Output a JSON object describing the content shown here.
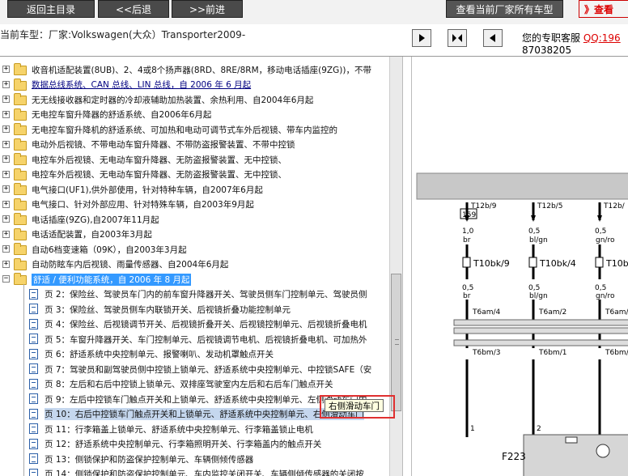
{
  "toolbar": {
    "back_main": "返回主目录",
    "back": "<<后退",
    "forward": ">>前进",
    "all_models": "查看当前厂家所有车型",
    "check": "》查看"
  },
  "info": {
    "current_model": "当前车型：厂家:Volkswagen(大众）Transporter2009-",
    "service_label": "您的专职客服",
    "service_qq": "QQ:196",
    "service_phone": "87038205"
  },
  "tree": {
    "folders": [
      {
        "label": "收音机适配装置(8UB)、2、4或8个扬声器(8RD、8RE/8RM，移动电话插座(9ZG))，不带",
        "style": "normal"
      },
      {
        "label": "数据总线系统、CAN 总线、LIN 总线，自 2006 年 6 月起",
        "style": "blue"
      },
      {
        "label": "无无线接收器和定时器的冷却液辅助加热装置、余热利用、自2004年6月起",
        "style": "normal"
      },
      {
        "label": "无电控车窗升降器的舒适系统、自2006年6月起",
        "style": "normal"
      },
      {
        "label": "无电控车窗升降机的舒适系统、可加热和电动可调节式车外后视镜、带车内监控的",
        "style": "normal"
      },
      {
        "label": "电动外后视镜、不带电动车窗升降器、不带防盗报警装置、不带中控锁",
        "style": "normal"
      },
      {
        "label": "电控车外后视镜、无电动车窗升降器、无防盗报警装置、无中控锁、",
        "style": "normal"
      },
      {
        "label": "电控车外后视镜、无电动车窗升降器、无防盗报警装置、无中控锁、",
        "style": "normal"
      },
      {
        "label": "电气接口(UF1),供外部使用，针对特种车辆，自2007年6月起",
        "style": "normal"
      },
      {
        "label": "电气接口、针对外部应用、针对特殊车辆，自2003年9月起",
        "style": "normal"
      },
      {
        "label": "电话插座(9ZG),自2007年11月起",
        "style": "normal"
      },
      {
        "label": "电话适配装置，自2003年3月起",
        "style": "normal"
      },
      {
        "label": "自动6档变速箱（09K），自2003年3月起",
        "style": "normal"
      },
      {
        "label": "自动防眩车内后视镜、雨量传感器、自2004年6月起",
        "style": "normal"
      },
      {
        "label": "舒适 / 便利功能系统，自 2006 年 8 月起",
        "style": "selected"
      }
    ],
    "pages": [
      "页 2：保险丝、驾驶员车门内的前车窗升降器开关、驾驶员侧车门控制单元、驾驶员侧",
      "页 3：保险丝、驾驶员侧车内联锁开关、后视镜折叠功能控制单元",
      "页 4：保险丝、后视镜调节开关、后视镜折叠开关、后视镜控制单元、后视镜折叠电机",
      "页 5：车窗升降器开关、车门控制单元、后视镜调节电机、后视镜折叠电机、可加热外",
      "页 6：舒适系统中央控制单元、报警喇叭、发动机罩触点开关",
      "页 7：驾驶员和副驾驶员侧中控锁上锁单元、舒适系统中央控制单元、中控锁SAFE（安",
      "页 8：左后和右后中控锁上锁单元、双排座驾驶室内左后和右后车门触点开关",
      "页 9：左后中控锁车门触点开关和上锁单元、舒适系统中央控制单元、左侧滑动车门内",
      "页 10：右后中控锁车门触点开关和上锁单元、舒适系统中央控制单元、右侧滑动车门",
      "页 11：行李箱盖上锁单元、舒适系统中央控制单元、行李箱盖锁止电机",
      "页 12：舒适系统中央控制单元、行李箱照明开关、行李箱盖内的触点开关",
      "页 13：侧锁保护和防盗保护控制单元、车辆侧倾传感器",
      "页 14：侧锁保护和防盗保护控制单元、车内监控关闭开关、车辆侧倾传感器的关闭按"
    ],
    "tooltip": "右侧滑动车门"
  },
  "diagram": {
    "box_label": "159",
    "columns": [
      {
        "top_conn": "T12b/9",
        "size1": "1,0",
        "color1": "br",
        "plug": "T10bk/9",
        "size2": "0,5",
        "color2": "br",
        "mid_conn": "T6am/4",
        "low_conn": "T6bm/3",
        "pin": "1"
      },
      {
        "top_conn": "T12b/5",
        "size1": "0,5",
        "color1": "bl/gn",
        "plug": "T10bk/4",
        "size2": "0,5",
        "color2": "bl/gn",
        "mid_conn": "T6am/2",
        "low_conn": "T6bm/1",
        "pin": "2"
      },
      {
        "top_conn": "T12b/",
        "size1": "0,5",
        "color1": "gn/ro",
        "plug": "T10b",
        "size2": "0,5",
        "color2": "gn/ro",
        "mid_conn": "T6am/",
        "low_conn": "T6bm/",
        "pin": ""
      }
    ],
    "component": "F223"
  }
}
